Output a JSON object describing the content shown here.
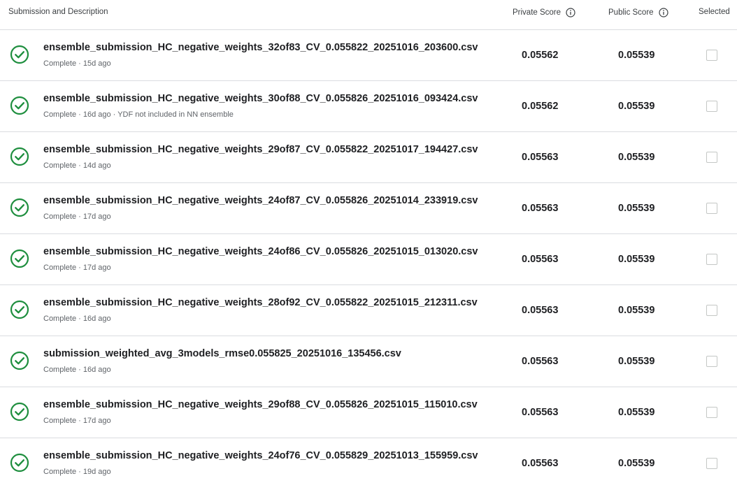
{
  "header": {
    "description_label": "Submission and Description",
    "private_label": "Private Score",
    "public_label": "Public Score",
    "selected_label": "Selected"
  },
  "colors": {
    "success": "#1e8e3e",
    "border": "#dadce0",
    "muted_text": "#5f6368"
  },
  "icons": {
    "status": "check-circle-icon",
    "info": "info-icon"
  },
  "submissions": [
    {
      "filename": "ensemble_submission_HC_negative_weights_32of83_CV_0.055822_20251016_203600.csv",
      "status": "Complete · 15d ago",
      "private": "0.05562",
      "public": "0.05539",
      "selected": false
    },
    {
      "filename": "ensemble_submission_HC_negative_weights_30of88_CV_0.055826_20251016_093424.csv",
      "status": "Complete · 16d ago · YDF not included in NN ensemble",
      "private": "0.05562",
      "public": "0.05539",
      "selected": false
    },
    {
      "filename": "ensemble_submission_HC_negative_weights_29of87_CV_0.055822_20251017_194427.csv",
      "status": "Complete · 14d ago",
      "private": "0.05563",
      "public": "0.05539",
      "selected": false
    },
    {
      "filename": "ensemble_submission_HC_negative_weights_24of87_CV_0.055826_20251014_233919.csv",
      "status": "Complete · 17d ago",
      "private": "0.05563",
      "public": "0.05539",
      "selected": false
    },
    {
      "filename": "ensemble_submission_HC_negative_weights_24of86_CV_0.055826_20251015_013020.csv",
      "status": "Complete · 17d ago",
      "private": "0.05563",
      "public": "0.05539",
      "selected": false
    },
    {
      "filename": "ensemble_submission_HC_negative_weights_28of92_CV_0.055822_20251015_212311.csv",
      "status": "Complete · 16d ago",
      "private": "0.05563",
      "public": "0.05539",
      "selected": false
    },
    {
      "filename": "submission_weighted_avg_3models_rmse0.055825_20251016_135456.csv",
      "status": "Complete · 16d ago",
      "private": "0.05563",
      "public": "0.05539",
      "selected": false
    },
    {
      "filename": "ensemble_submission_HC_negative_weights_29of88_CV_0.055826_20251015_115010.csv",
      "status": "Complete · 17d ago",
      "private": "0.05563",
      "public": "0.05539",
      "selected": false
    },
    {
      "filename": "ensemble_submission_HC_negative_weights_24of76_CV_0.055829_20251013_155959.csv",
      "status": "Complete · 19d ago",
      "private": "0.05563",
      "public": "0.05539",
      "selected": false
    }
  ]
}
